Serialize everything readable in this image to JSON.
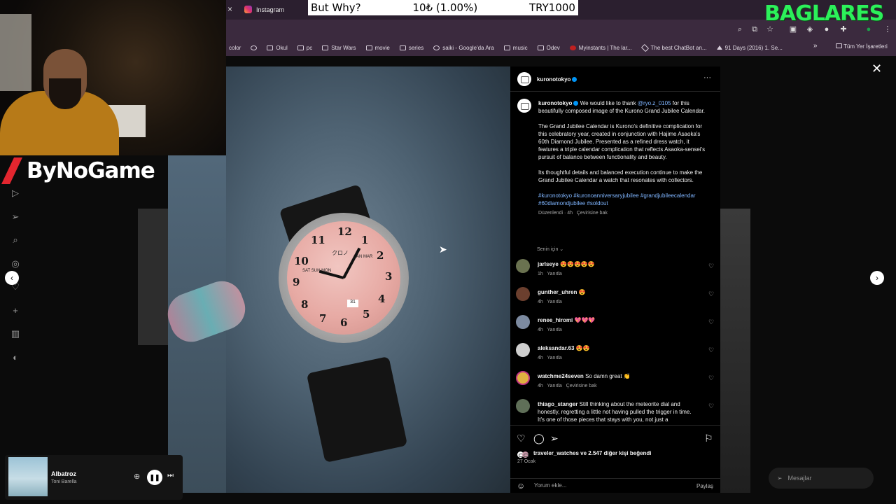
{
  "browser": {
    "tab_title": "Instagram",
    "tab_close": "×",
    "bookmarks": [
      "color",
      "",
      "Okul",
      "pc",
      "Star Wars",
      "movie",
      "series",
      "saiki - Google'da Ara",
      "music",
      "Ödev",
      "Myinstants | The lar...",
      "The best ChatBot an...",
      "91 Days (2016) 1. Se..."
    ],
    "bookmarks_more": "»",
    "all_bookmarks": "Tüm Yer İşaretleri"
  },
  "stream": {
    "donation_title": "But Why?",
    "donation_amount": "10₺ (1.00%)",
    "donation_goal": "TRY1000",
    "channel_name": "BAGLARES",
    "sponsor": "ByNoGame"
  },
  "post": {
    "username": "kuronotokyo",
    "more": "···",
    "caption_user": "kuronotokyo",
    "caption_p1_a": "We would like to thank",
    "caption_mention": "@ryo.z_0105",
    "caption_p1_b": "for this beautifully composed image of the Kurono Grand Jubilee Calendar.",
    "caption_p2": "The Grand Jubilee Calendar is Kurono's definitive complication for this celebratory year, created in conjunction with Hajime Asaoka's 60th Diamond Jubilee. Presented as a refined dress watch, it features a triple calendar complication that reflects Asaoka-sensei's pursuit of balance between functionality and beauty.",
    "caption_p3": "Its thoughtful details and balanced execution continue to make the Grand Jubilee Calendar a watch that resonates with collectors.",
    "hashtags": "#kuronotokyo #kuronoanniversaryjubilee #grandjubileecalendar #60diamondjubilee #soldout",
    "edited_meta": "Düzenlendi · 4h",
    "translate": "Çevirisine bak",
    "for_you": "Senin için ⌄",
    "likes": "traveler_watches ve 2.547 diğer kişi beğendi",
    "date": "27 Ocak",
    "comment_placeholder": "Yorum ekle...",
    "share": "Paylaş"
  },
  "comments": [
    {
      "user": "jarlseye",
      "text": "😍😍😍😍😍",
      "time": "1h",
      "reply": "Yanıtla",
      "translate": ""
    },
    {
      "user": "gunther_uhren",
      "text": "😍",
      "time": "4h",
      "reply": "Yanıtla",
      "translate": ""
    },
    {
      "user": "renee_hiromi",
      "text": "💖💖💖",
      "time": "4h",
      "reply": "Yanıtla",
      "translate": ""
    },
    {
      "user": "aleksandar.63",
      "text": "😍😍",
      "time": "4h",
      "reply": "Yanıtla",
      "translate": ""
    },
    {
      "user": "watchme24seven",
      "text": "So damn great 👏",
      "time": "4h",
      "reply": "Yanıtla",
      "translate": "Çevirisine bak"
    },
    {
      "user": "thiago_stanger",
      "text": "Still thinking about the meteorite dial and honestly, regretting a little not having pulled the trigger in time.",
      "text2": "It's one of those pieces that stays with you, not just a",
      "time": "",
      "reply": "",
      "translate": ""
    }
  ],
  "watch_dial": {
    "numerals": [
      "1",
      "2",
      "3",
      "4",
      "5",
      "6",
      "7",
      "8",
      "9",
      "10",
      "11",
      "12"
    ],
    "brand": "クロノ",
    "day": "SAT SUN MON",
    "month": "JAN MAR",
    "date_window": "31"
  },
  "messages": {
    "label": "Mesajlar"
  },
  "player": {
    "song": "Albatroz",
    "artist": "Toni Barella"
  },
  "colors": {
    "instagram_bg": "#000000",
    "link_blue": "#7fb5ff",
    "verified": "#0095f6",
    "channel_green": "#2cf05a",
    "sponsor_red": "#e3262f",
    "dial_pink": "#e7aaa4"
  }
}
